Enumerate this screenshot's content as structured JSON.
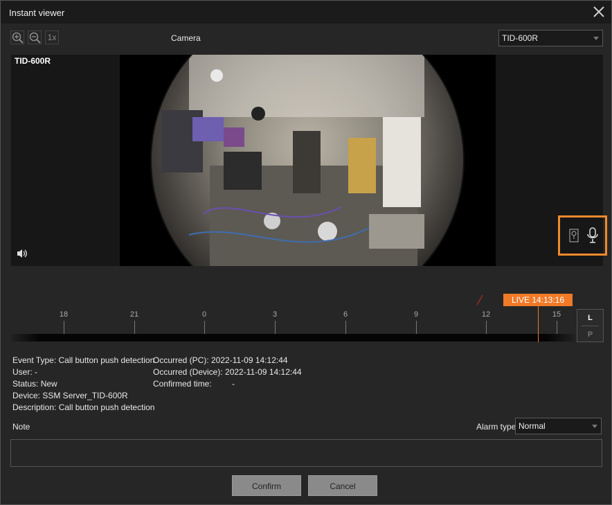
{
  "window": {
    "title": "Instant viewer"
  },
  "toolbar": {
    "zoom_in_icon": "zoom-in-icon",
    "zoom_out_icon": "zoom-out-icon",
    "reset_label": "1x",
    "camera_label": "Camera",
    "camera_value": "TID-600R"
  },
  "video": {
    "camera_name": "TID-600R",
    "speaker_icon": "speaker-icon",
    "overlay_icons": [
      "call-button-icon",
      "microphone-icon"
    ]
  },
  "timeline": {
    "ticks": [
      "18",
      "21",
      "0",
      "3",
      "6",
      "9",
      "12",
      "15"
    ],
    "live_label": "LIVE 14:13:16",
    "mode_l": "L",
    "mode_p": "P"
  },
  "event": {
    "type": "Event Type: Call button push detection",
    "user": "User: -",
    "status": "Status: New",
    "device": "Device: SSM Server_TID-600R",
    "description": "Description: Call button push detection",
    "occurred_pc": "Occurred (PC): 2022-11-09 14:12:44",
    "occurred_device": "Occurred (Device): 2022-11-09 14:12:44",
    "confirmed_label": "Confirmed time:",
    "confirmed_value": "-"
  },
  "form": {
    "note_label": "Note",
    "alarm_type_label": "Alarm type",
    "alarm_type_value": "Normal",
    "confirm_label": "Confirm",
    "cancel_label": "Cancel"
  },
  "colors": {
    "accent": "#f07a28",
    "background": "#262626"
  }
}
